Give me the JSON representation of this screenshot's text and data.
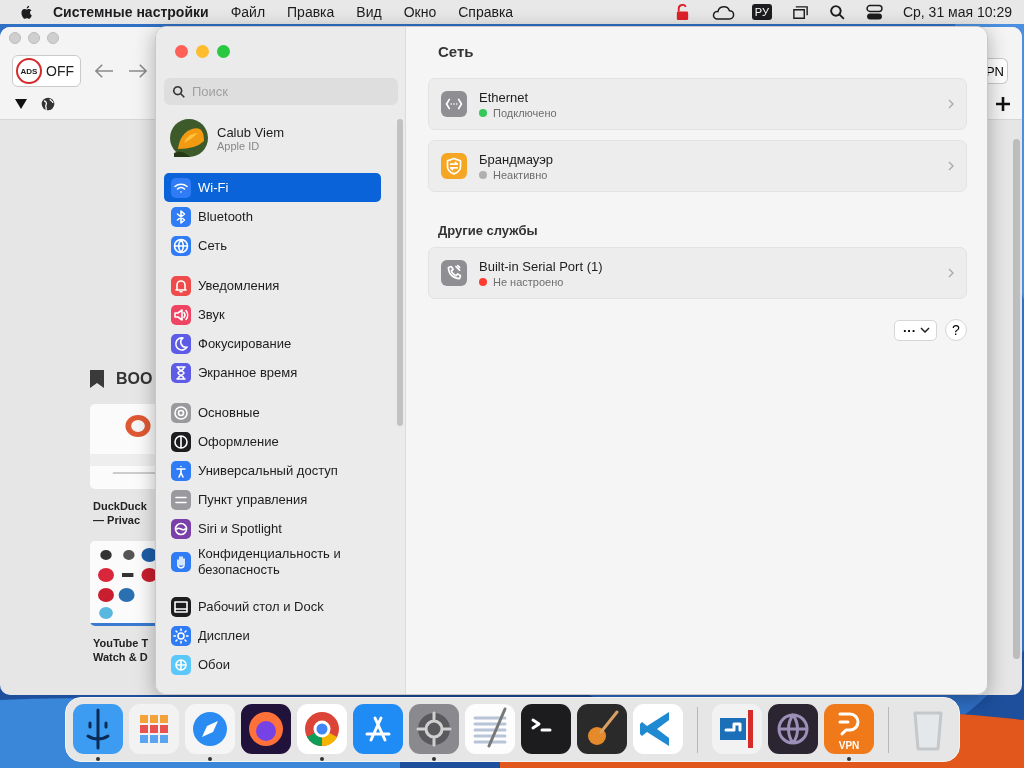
{
  "menu_bar": {
    "app_name": "Системные настройки",
    "menus": [
      "Файл",
      "Правка",
      "Вид",
      "Окно",
      "Справка"
    ],
    "input_source": "РУ",
    "datetime": "Ср, 31 мая  10:29"
  },
  "browser": {
    "ads_toggle": {
      "badge": "ADS",
      "label": "OFF"
    },
    "right_button": {
      "label": "PN"
    },
    "bookmarks_heading": "BOO",
    "bookmarks": [
      {
        "title_lines": [
          "DuckDuck",
          "— Privac"
        ]
      },
      {
        "title_lines": [
          "YouTube T",
          "Watch & D"
        ]
      }
    ]
  },
  "settings": {
    "search": {
      "placeholder": "Поиск"
    },
    "account": {
      "name": "Calub Viem",
      "subtitle": "Apple ID"
    },
    "sidebar_groups": [
      {
        "items": [
          {
            "kind": "wifi",
            "label": "Wi-Fi",
            "selected": true
          },
          {
            "kind": "bluetooth",
            "label": "Bluetooth",
            "selected": false
          },
          {
            "kind": "network",
            "label": "Сеть",
            "selected": false
          }
        ]
      },
      {
        "items": [
          {
            "kind": "notifications",
            "label": "Уведомления",
            "selected": false
          },
          {
            "kind": "sound",
            "label": "Звук",
            "selected": false
          },
          {
            "kind": "focus",
            "label": "Фокусирование",
            "selected": false
          },
          {
            "kind": "screen_time",
            "label": "Экранное время",
            "selected": false
          }
        ]
      },
      {
        "items": [
          {
            "kind": "general",
            "label": "Основные",
            "selected": false
          },
          {
            "kind": "appearance",
            "label": "Оформление",
            "selected": false
          },
          {
            "kind": "accessibility",
            "label": "Универсальный доступ",
            "selected": false
          },
          {
            "kind": "control_center",
            "label": "Пункт управления",
            "selected": false
          },
          {
            "kind": "siri",
            "label": "Siri и Spotlight",
            "selected": false
          },
          {
            "kind": "privacy",
            "label": "Конфиденциальность и безопасность",
            "selected": false
          }
        ]
      },
      {
        "items": [
          {
            "kind": "dock",
            "label": "Рабочий стол и Dock",
            "selected": false
          },
          {
            "kind": "displays",
            "label": "Дисплеи",
            "selected": false
          },
          {
            "kind": "wallpaper",
            "label": "Обои",
            "selected": false
          }
        ]
      }
    ],
    "title": "Сеть",
    "services": [
      {
        "kind": "ethernet",
        "name": "Ethernet",
        "status": "Подключено",
        "color": "#34c759"
      },
      {
        "kind": "firewall",
        "name": "Брандмауэр",
        "status": "Неактивно",
        "color": "#b0b0b0"
      }
    ],
    "other_heading": "Другие службы",
    "other_services": [
      {
        "kind": "phone",
        "name": "Built-in Serial Port (1)",
        "status": "Не настроено",
        "color": "#ff3b30"
      }
    ],
    "actions_button": "···",
    "help_button": "?"
  },
  "dock": {
    "groups": [
      {
        "items": [
          {
            "kind": "finder",
            "running": true
          },
          {
            "kind": "launchpad",
            "running": false
          },
          {
            "kind": "safari",
            "running": true
          },
          {
            "kind": "firefox",
            "running": false
          },
          {
            "kind": "chrome",
            "running": true
          },
          {
            "kind": "app_store",
            "running": false
          },
          {
            "kind": "settings",
            "running": true
          },
          {
            "kind": "textedit",
            "running": false
          },
          {
            "kind": "terminal",
            "running": false
          },
          {
            "kind": "garageband",
            "running": false
          },
          {
            "kind": "vscode",
            "running": false
          }
        ]
      },
      {
        "items": [
          {
            "kind": "parallels",
            "running": false
          },
          {
            "kind": "globe_app",
            "running": false
          },
          {
            "kind": "vpn",
            "running": true,
            "badge": "VPN"
          }
        ]
      },
      {
        "items": [
          {
            "kind": "trash",
            "running": false
          }
        ]
      }
    ]
  }
}
